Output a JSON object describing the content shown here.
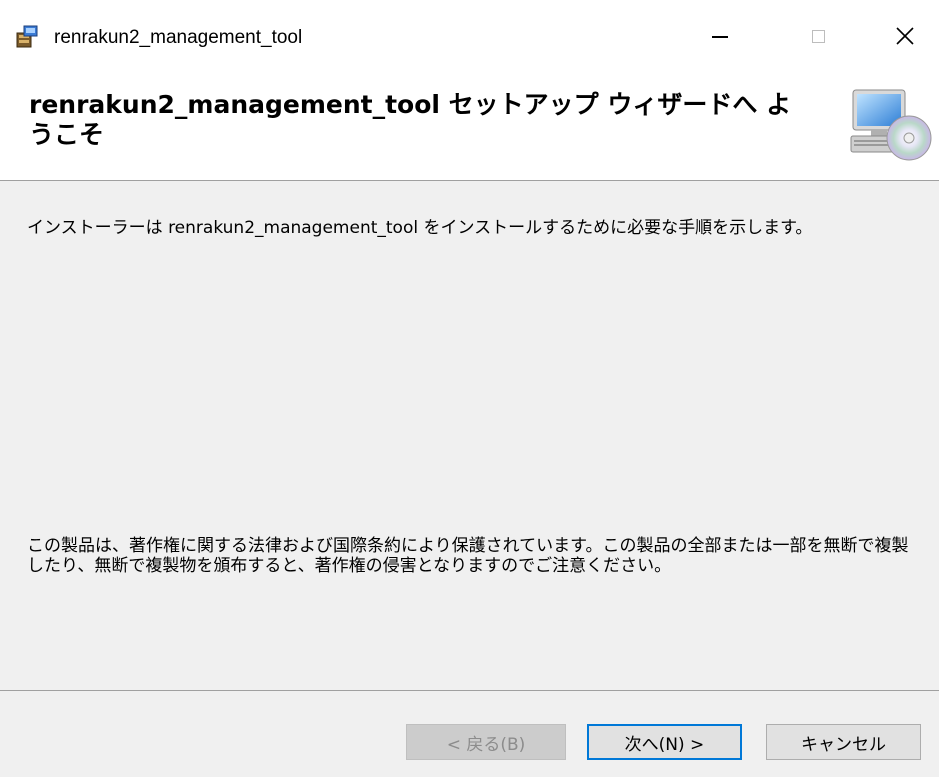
{
  "window": {
    "title": "renrakun2_management_tool",
    "controls": {
      "minimize": "—",
      "maximize": "□",
      "close": "✕"
    }
  },
  "banner": {
    "title": "renrakun2_management_tool セットアップ ウィザードへ ようこそ",
    "icon": "computer-cd-icon"
  },
  "content": {
    "intro": "インストーラーは renrakun2_management_tool をインストールするために必要な手順を示します。",
    "copyright": "この製品は、著作権に関する法律および国際条約により保護されています。この製品の全部または一部を無断で複製したり、無断で複製物を頒布すると、著作権の侵害となりますのでご注意ください。"
  },
  "buttons": {
    "back": "< 戻る(B)",
    "next": "次へ(N) >",
    "cancel": "キャンセル"
  },
  "colors": {
    "accent": "#0078d7",
    "background": "#f0f0f0",
    "banner": "#ffffff"
  }
}
